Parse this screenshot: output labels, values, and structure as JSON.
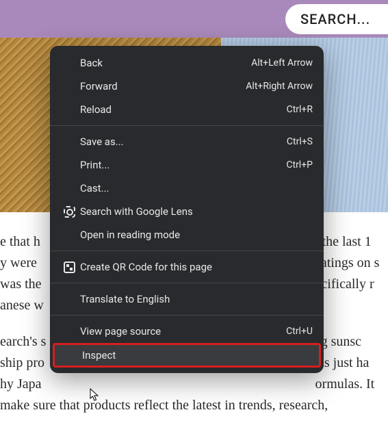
{
  "header": {
    "search_placeholder": "SEARCH..."
  },
  "article": {
    "para1": "e that h~~~~~~~~~~~~~~~~~~~~~~~~~~~~~~~~r the last 1~ y were ~~~~~~~~~~~~~~~~~~~~~~~~~~~~~~~~atings on s~ was the~~~~~~~~~~~~~~~~~~~~~~~~~~~~~~~~pecifically r~ anese w",
    "para2": "earch's s~~~~~~~~~~~~~~~~~~~~~~~~~~~~~~~ling sunsc~ ship pro~~~~~~~~~~~~~~~~~~~~~~~~~~~~~~~has just ha~ hy Japa~~~~~~~~~~~~~~~~~~~~~~~~~~~~~~~ormulas. It~ make sure that products reflect the latest in trends, research,"
  },
  "context_menu": {
    "back": {
      "label": "Back",
      "shortcut": "Alt+Left Arrow"
    },
    "forward": {
      "label": "Forward",
      "shortcut": "Alt+Right Arrow"
    },
    "reload": {
      "label": "Reload",
      "shortcut": "Ctrl+R"
    },
    "save_as": {
      "label": "Save as...",
      "shortcut": "Ctrl+S"
    },
    "print": {
      "label": "Print...",
      "shortcut": "Ctrl+P"
    },
    "cast": {
      "label": "Cast..."
    },
    "lens": {
      "label": "Search with Google Lens"
    },
    "reading": {
      "label": "Open in reading mode"
    },
    "qr": {
      "label": "Create QR Code for this page"
    },
    "translate": {
      "label": "Translate to English"
    },
    "source": {
      "label": "View page source",
      "shortcut": "Ctrl+U"
    },
    "inspect": {
      "label": "Inspect"
    }
  }
}
